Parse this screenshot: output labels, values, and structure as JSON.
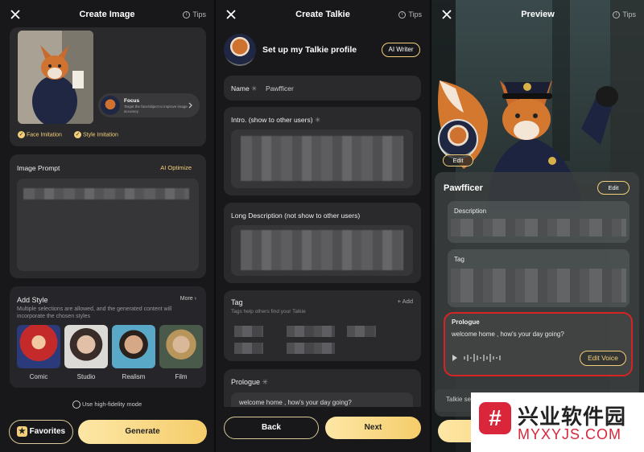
{
  "create_image": {
    "title": "Create Image",
    "tips": "Tips",
    "focus_title": "Focus",
    "focus_desc": "Target the face/object to improve image accuracy",
    "face_imitation": "Face Imitation",
    "style_imitation": "Style Imitation",
    "prompt_label": "Image Prompt",
    "ai_optimize": "AI Optimize",
    "add_style": "Add Style",
    "more": "More",
    "style_desc": "Multiple selections are allowed, and the generated content will incorporate the chosen styles",
    "styles": [
      "Comic",
      "Studio",
      "Realism",
      "Film"
    ],
    "high_fidelity": "Use high-fidelity mode",
    "favorites": "Favorites",
    "generate": "Generate"
  },
  "create_talkie": {
    "title": "Create Talkie",
    "tips": "Tips",
    "profile_heading": "Set up my Talkie profile",
    "ai_writer": "AI Writer",
    "name_label": "Name",
    "name_value": "Pawfficer",
    "intro_label": "Intro. (show to other users)",
    "long_desc_label": "Long Description (not show to other users)",
    "tag_label": "Tag",
    "tag_add": "Add",
    "tag_hint": "Tags help others find your Talkie",
    "prologue_label": "Prologue",
    "prologue_value": "welcome home , how's your day going?",
    "back": "Back",
    "next": "Next"
  },
  "preview": {
    "title": "Preview",
    "tips": "Tips",
    "edit_avatar": "Edit",
    "name": "Pawfficer",
    "edit_name": "Edit",
    "description_label": "Description",
    "tag_label": "Tag",
    "prologue_label": "Prologue",
    "prologue_text": "welcome home , how's your day going?",
    "edit_voice": "Edit Voice",
    "talkie_setting": "Talkie se"
  },
  "watermark": {
    "cn": "兴业软件园",
    "en": "MYXYJS.COM"
  }
}
